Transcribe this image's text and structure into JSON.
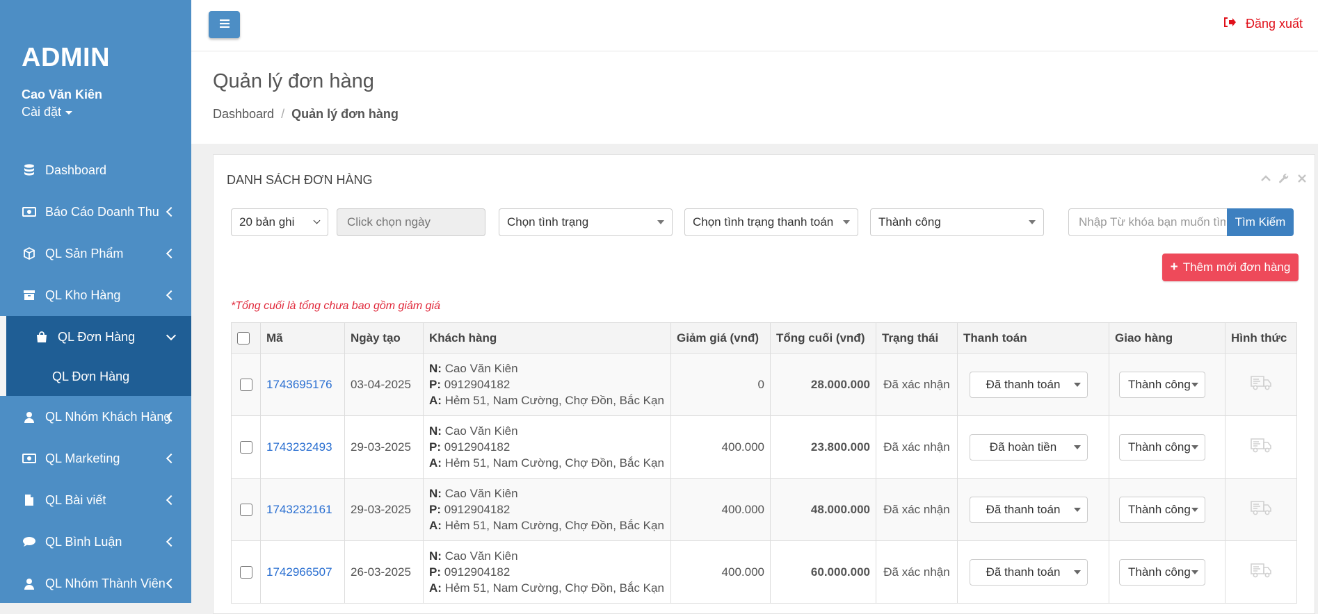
{
  "sidebar": {
    "brand": "ADMIN",
    "user_name": "Cao Văn Kiên",
    "settings_label": "Cài đặt",
    "items": [
      {
        "label": "Dashboard",
        "icon": "database-icon"
      },
      {
        "label": "Báo Cáo Doanh Thu",
        "icon": "money-icon"
      },
      {
        "label": "QL Sản Phẩm",
        "icon": "cube-icon"
      },
      {
        "label": "QL Kho Hàng",
        "icon": "archive-icon"
      },
      {
        "label": "QL Đơn Hàng",
        "icon": "shopping-bag-icon"
      },
      {
        "label": "QL Nhóm Khách Hàng",
        "icon": "user-icon"
      },
      {
        "label": "QL Marketing",
        "icon": "money-icon"
      },
      {
        "label": "QL Bài viết",
        "icon": "file-icon"
      },
      {
        "label": "QL Bình Luận",
        "icon": "comment-icon"
      },
      {
        "label": "QL Nhóm Thành Viên",
        "icon": "user-icon"
      }
    ],
    "active_sub_item": "QL Đơn Hàng"
  },
  "topbar": {
    "menu_icon": "hamburger-icon",
    "logout_label": "Đăng xuất",
    "logout_color": "#e0101a"
  },
  "page": {
    "title": "Quản lý đơn hàng",
    "breadcrumb": [
      "Dashboard",
      "Quản lý đơn hàng"
    ]
  },
  "panel": {
    "title": "DANH SÁCH ĐƠN HÀNG",
    "filters": {
      "page_size": "20 bản ghi",
      "date_placeholder": "Click chọn ngày",
      "status": "Chọn tình trạng",
      "payment_status": "Chọn tình trạng thanh toán",
      "delivery_status": "Thành công",
      "search_placeholder": "Nhập Từ khóa bạn muốn tìm",
      "search_button": "Tìm Kiếm"
    },
    "add_button": "Thêm mới đơn hàng",
    "note": "*Tổng cuối là tổng chưa bao gồm giảm giá"
  },
  "table": {
    "columns": [
      "Mã",
      "Ngày tạo",
      "Khách hàng",
      "Giảm giá (vnđ)",
      "Tổng cuối (vnđ)",
      "Trạng thái",
      "Thanh toán",
      "Giao hàng",
      "Hình thức"
    ],
    "customer_labels": {
      "name": "N:",
      "phone": "P:",
      "address": "A:"
    },
    "rows": [
      {
        "code": "1743695176",
        "date": "03-04-2025",
        "name": "Cao Văn Kiên",
        "phone": "0912904182",
        "address": "Hẻm 51, Nam Cường, Chợ Đồn, Bắc Kạn",
        "discount": "0",
        "total": "28.000.000",
        "status": "Đã xác nhận",
        "payment": "Đã thanh toán",
        "delivery": "Thành công"
      },
      {
        "code": "1743232493",
        "date": "29-03-2025",
        "name": "Cao Văn Kiên",
        "phone": "0912904182",
        "address": "Hẻm 51, Nam Cường, Chợ Đồn, Bắc Kạn",
        "discount": "400.000",
        "total": "23.800.000",
        "status": "Đã xác nhận",
        "payment": "Đã hoàn tiền",
        "delivery": "Thành công"
      },
      {
        "code": "1743232161",
        "date": "29-03-2025",
        "name": "Cao Văn Kiên",
        "phone": "0912904182",
        "address": "Hẻm 51, Nam Cường, Chợ Đồn, Bắc Kạn",
        "discount": "400.000",
        "total": "48.000.000",
        "status": "Đã xác nhận",
        "payment": "Đã thanh toán",
        "delivery": "Thành công"
      },
      {
        "code": "1742966507",
        "date": "26-03-2025",
        "name": "Cao Văn Kiên",
        "phone": "0912904182",
        "address": "Hẻm 51, Nam Cường, Chợ Đồn, Bắc Kạn",
        "discount": "400.000",
        "total": "60.000.000",
        "status": "Đã xác nhận",
        "payment": "Đã thanh toán",
        "delivery": "Thành công"
      }
    ]
  },
  "colors": {
    "sidebar": "#4d8ec5",
    "sidebar_active": "#1f5e95",
    "add_button": "#ee4a5a",
    "search_button": "#3d80c0",
    "link": "#2a6fd1",
    "discount": "#e00000",
    "total": "#1e5fd1"
  }
}
